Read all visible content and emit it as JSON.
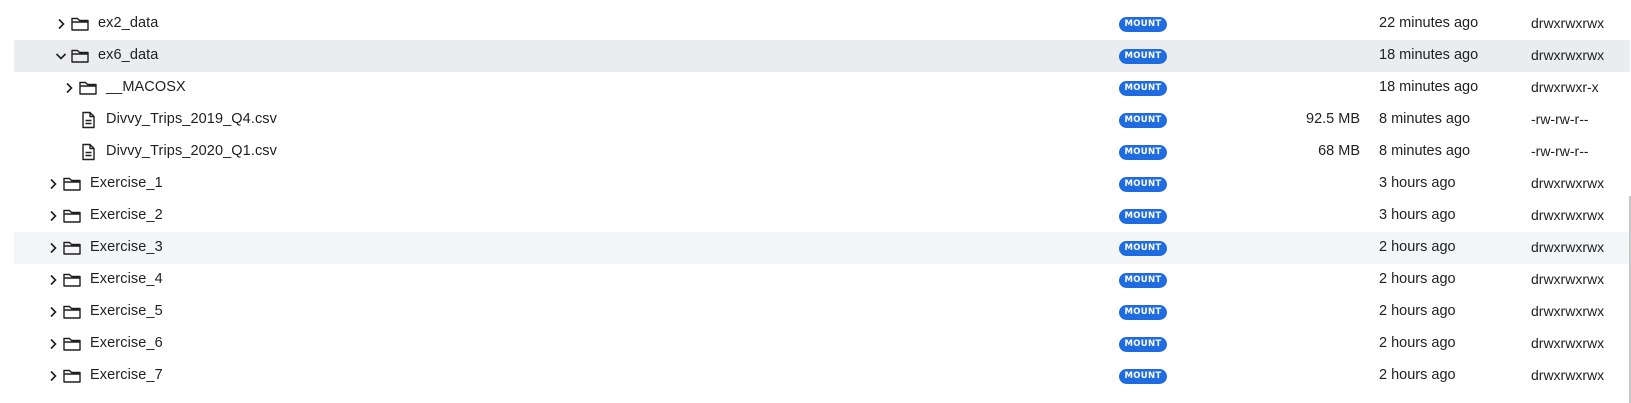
{
  "file_browser": {
    "badge_label": "MOUNT",
    "rows": [
      {
        "name": "ex2_data",
        "type": "folder",
        "expanded": false,
        "size": "",
        "modified": "22 minutes ago",
        "permissions": "drwxrwxrwx"
      },
      {
        "name": "ex6_data",
        "type": "folder",
        "expanded": true,
        "size": "",
        "modified": "18 minutes ago",
        "permissions": "drwxrwxrwx",
        "selected": true
      },
      {
        "name": "__MACOSX",
        "type": "folder",
        "expanded": false,
        "size": "",
        "modified": "18 minutes ago",
        "permissions": "drwxrwxr-x"
      },
      {
        "name": "Divvy_Trips_2019_Q4.csv",
        "type": "file",
        "size": "92.5 MB",
        "modified": "8 minutes ago",
        "permissions": "-rw-rw-r--"
      },
      {
        "name": "Divvy_Trips_2020_Q1.csv",
        "type": "file",
        "size": "68 MB",
        "modified": "8 minutes ago",
        "permissions": "-rw-rw-r--"
      },
      {
        "name": "Exercise_1",
        "type": "folder",
        "expanded": false,
        "size": "",
        "modified": "3 hours ago",
        "permissions": "drwxrwxrwx"
      },
      {
        "name": "Exercise_2",
        "type": "folder",
        "expanded": false,
        "size": "",
        "modified": "3 hours ago",
        "permissions": "drwxrwxrwx"
      },
      {
        "name": "Exercise_3",
        "type": "folder",
        "expanded": false,
        "size": "",
        "modified": "2 hours ago",
        "permissions": "drwxrwxrwx",
        "hovered": true
      },
      {
        "name": "Exercise_4",
        "type": "folder",
        "expanded": false,
        "size": "",
        "modified": "2 hours ago",
        "permissions": "drwxrwxrwx"
      },
      {
        "name": "Exercise_5",
        "type": "folder",
        "expanded": false,
        "size": "",
        "modified": "2 hours ago",
        "permissions": "drwxrwxrwx"
      },
      {
        "name": "Exercise_6",
        "type": "folder",
        "expanded": false,
        "size": "",
        "modified": "2 hours ago",
        "permissions": "drwxrwxrwx"
      },
      {
        "name": "Exercise_7",
        "type": "folder",
        "expanded": false,
        "size": "",
        "modified": "2 hours ago",
        "permissions": "drwxrwxrwx"
      }
    ]
  },
  "colors": {
    "badge": "#1f6ce0",
    "selected_row": "#ebecef",
    "hover_row": "#f4f5f6"
  }
}
